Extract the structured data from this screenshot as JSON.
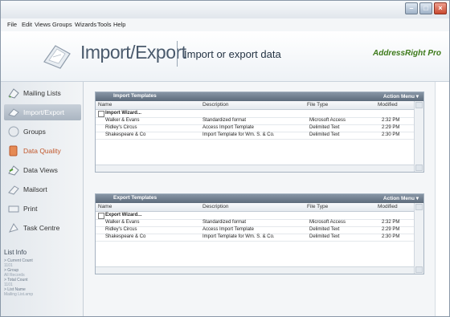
{
  "menu": [
    "File",
    "Edit",
    "Views",
    "Groups",
    "Wizards",
    "Tools",
    "Help"
  ],
  "header": {
    "title": "Import/Export",
    "subtitle": "Import or export data",
    "brand": "AddressRight Pro"
  },
  "sidebar": [
    {
      "label": "Mailing Lists"
    },
    {
      "label": "Import/Export"
    },
    {
      "label": "Groups"
    },
    {
      "label": "Data Quality"
    },
    {
      "label": "Data Views"
    },
    {
      "label": "Mailsort"
    },
    {
      "label": "Print"
    },
    {
      "label": "Task Centre"
    }
  ],
  "list_info": {
    "heading": "List Info",
    "items": [
      "> Current Count",
      "1101",
      "> Group",
      "All Records",
      "> Total Count",
      "1101",
      "> List Name",
      "Mailing List.amp"
    ]
  },
  "columns": [
    "Name",
    "Description",
    "File Type",
    "Modified"
  ],
  "import_panel": {
    "title": "Import Templates",
    "action": "Action Menu ▾",
    "rows": [
      {
        "name": "Import Wizard...",
        "desc": "",
        "type": "",
        "mod": ""
      },
      {
        "name": "Walker & Evans",
        "desc": "Standardized format",
        "type": "Microsoft Access",
        "mod": "2:32 PM"
      },
      {
        "name": "Ridley's Circus",
        "desc": "Access Import Template",
        "type": "Delimited Text",
        "mod": "2:29 PM"
      },
      {
        "name": "Shakespeare & Co",
        "desc": "Import Template for Wm. S. & Co.",
        "type": "Delimited Text",
        "mod": "2:30 PM"
      }
    ]
  },
  "export_panel": {
    "title": "Export Templates",
    "action": "Action Menu ▾",
    "rows": [
      {
        "name": "Export Wizard...",
        "desc": "",
        "type": "",
        "mod": ""
      },
      {
        "name": "Walker & Evans",
        "desc": "Standardized format",
        "type": "Microsoft Access",
        "mod": "2:32 PM"
      },
      {
        "name": "Ridley's Circus",
        "desc": "Access Import Template",
        "type": "Delimited Text",
        "mod": "2:29 PM"
      },
      {
        "name": "Shakespeare & Co",
        "desc": "Import Template for Wm. S. & Co.",
        "type": "Delimited Text",
        "mod": "2:30 PM"
      }
    ]
  },
  "colors": {
    "accent": "#3d7a1a",
    "panel_header": "#6a7888",
    "active_nav": "#b8c2cd"
  }
}
